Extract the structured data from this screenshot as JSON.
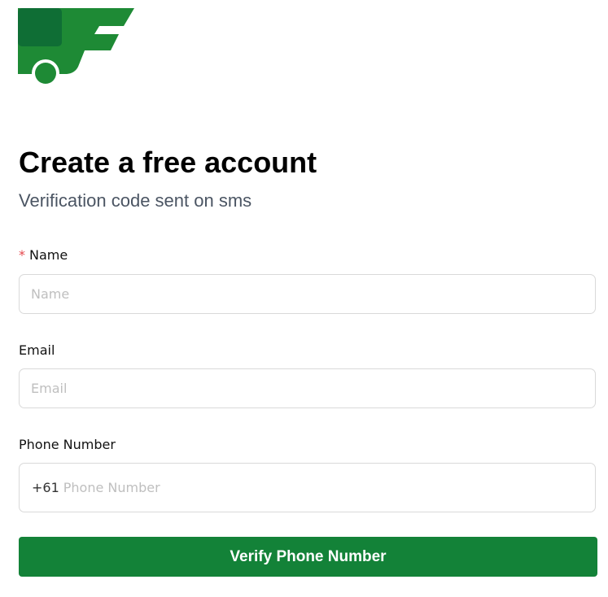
{
  "brand": {
    "logo_icon": "truck-letter-f-logo-icon",
    "colors": {
      "primary": "#138238",
      "logo_dark": "#0f6e35",
      "logo_light": "#1e8a35"
    }
  },
  "header": {
    "title": "Create a free account",
    "subtitle": "Verification code sent on sms"
  },
  "form": {
    "name": {
      "required_mark": "*",
      "label": "Name",
      "placeholder": "Name",
      "value": ""
    },
    "email": {
      "label": "Email",
      "placeholder": "Email",
      "value": ""
    },
    "phone": {
      "label": "Phone Number",
      "prefix": "+61",
      "placeholder": "Phone Number",
      "value": ""
    },
    "submit_label": "Verify Phone Number"
  }
}
